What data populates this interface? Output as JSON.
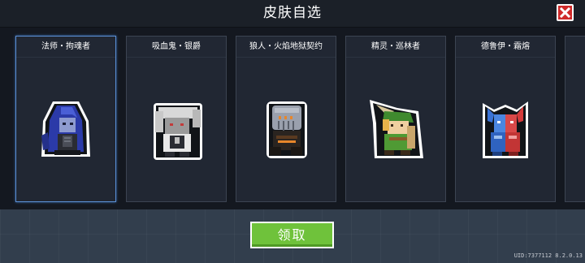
{
  "header": {
    "title": "皮肤自选"
  },
  "close_button": {
    "icon": "close-icon",
    "color": "#cf2a2a"
  },
  "skins": [
    {
      "name": "法师・拘魂者",
      "selected": true
    },
    {
      "name": "吸血鬼・银爵",
      "selected": false
    },
    {
      "name": "狼人・火焰地狱契约",
      "selected": false
    },
    {
      "name": "精灵・巡林者",
      "selected": false
    },
    {
      "name": "德鲁伊・霜熔",
      "selected": false
    }
  ],
  "claim_button": {
    "label": "领取",
    "color": "#6fc23b"
  },
  "footer": {
    "uid": "UID:7377112  8.2.0.13"
  }
}
